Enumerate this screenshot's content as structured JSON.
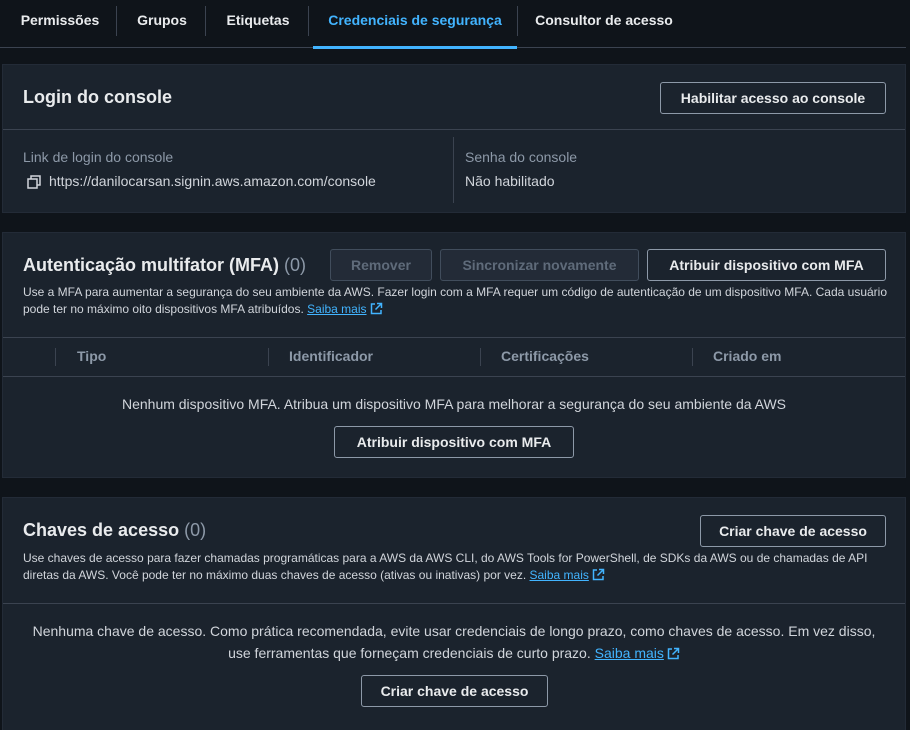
{
  "tabs": [
    {
      "label": "Permissões"
    },
    {
      "label": "Grupos"
    },
    {
      "label": "Etiquetas"
    },
    {
      "label": "Credenciais de segurança"
    },
    {
      "label": "Consultor de acesso"
    }
  ],
  "console_login": {
    "title": "Login do console",
    "enable_button": "Habilitar acesso ao console",
    "link_label": "Link de login do console",
    "link_value": "https://danilocarsan.signin.aws.amazon.com/console",
    "password_label": "Senha do console",
    "password_value": "Não habilitado"
  },
  "mfa": {
    "title": "Autenticação multifator (MFA)",
    "count": "(0)",
    "remove_button": "Remover",
    "resync_button": "Sincronizar novamente",
    "assign_button": "Atribuir dispositivo com MFA",
    "description": "Use a MFA para aumentar a segurança do seu ambiente da AWS. Fazer login com a MFA requer um código de autenticação de um dispositivo MFA. Cada usuário pode ter no máximo oito dispositivos MFA atribuídos.",
    "learn_more": "Saiba mais",
    "columns": [
      "Tipo",
      "Identificador",
      "Certificações",
      "Criado em"
    ],
    "empty_text": "Nenhum dispositivo MFA. Atribua um dispositivo MFA para melhorar a segurança do seu ambiente da AWS",
    "empty_button": "Atribuir dispositivo com MFA"
  },
  "access_keys": {
    "title": "Chaves de acesso",
    "count": "(0)",
    "create_button": "Criar chave de acesso",
    "description": "Use chaves de acesso para fazer chamadas programáticas para a AWS da AWS CLI, do AWS Tools for PowerShell, de SDKs da AWS ou de chamadas de API diretas da AWS. Você pode ter no máximo duas chaves de acesso (ativas ou inativas) por vez.",
    "learn_more": "Saiba mais",
    "empty_text": "Nenhuma chave de acesso. Como prática recomendada, evite usar credenciais de longo prazo, como chaves de acesso. Em vez disso, use ferramentas que forneçam credenciais de curto prazo.",
    "empty_learn_more": "Saiba mais",
    "empty_button": "Criar chave de acesso"
  },
  "colors": {
    "accent": "#42b4ff",
    "panel_bg": "#1b232d",
    "page_bg": "#0f141a"
  }
}
